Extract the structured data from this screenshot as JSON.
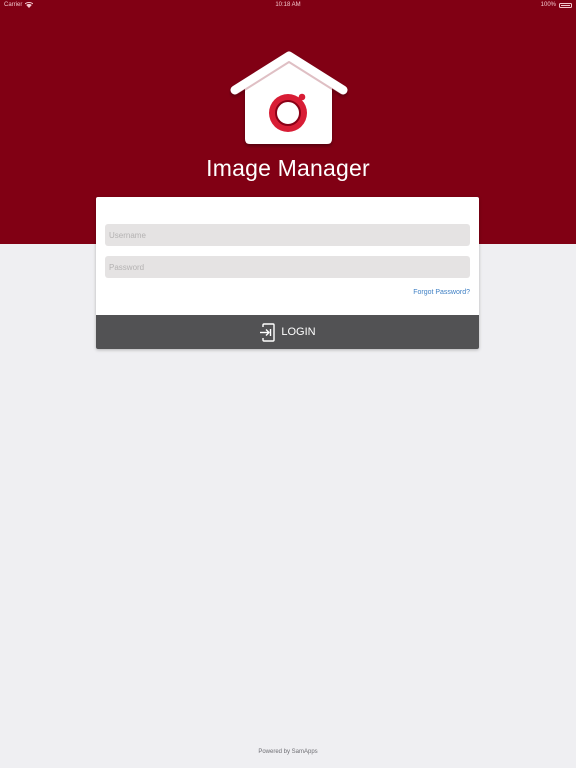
{
  "status_bar": {
    "carrier": "Carrier",
    "time": "10:18 AM",
    "battery": "100%"
  },
  "app": {
    "title": "Image Manager",
    "logo_icon": "house-camera-logo"
  },
  "login_form": {
    "username_placeholder": "Username",
    "password_placeholder": "Password",
    "forgot_password": "Forgot Password?",
    "login_label": "LOGIN",
    "login_icon": "login-icon"
  },
  "footer": {
    "text": "Powered by SamApps"
  },
  "colors": {
    "brand_red": "#810014",
    "button_gray": "#525254",
    "link_blue": "#3d7fc4",
    "background": "#efeff2"
  }
}
